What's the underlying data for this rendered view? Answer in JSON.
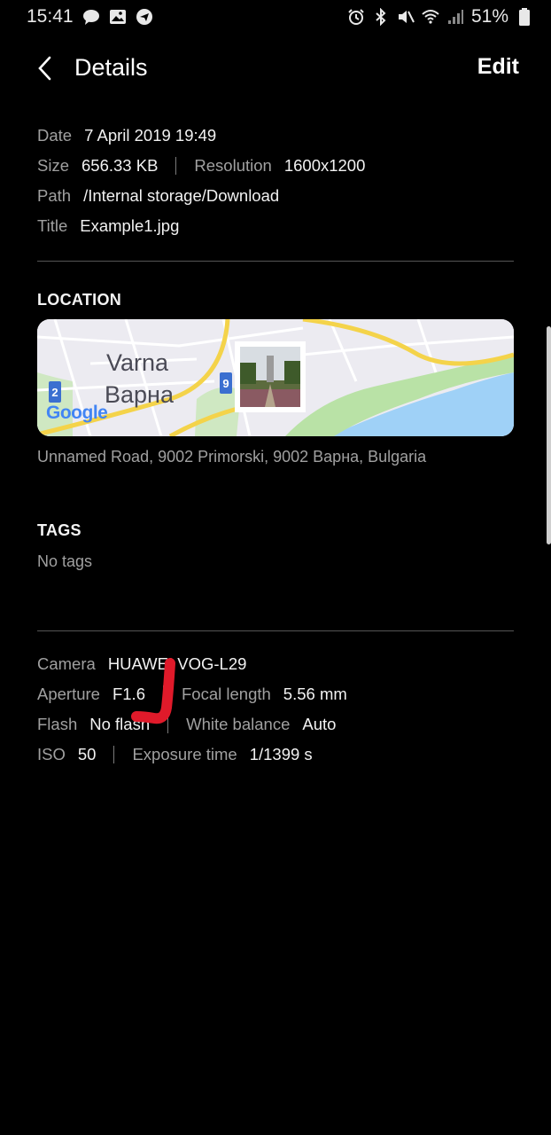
{
  "status_bar": {
    "time": "15:41",
    "battery": "51%"
  },
  "header": {
    "title": "Details",
    "edit_label": "Edit"
  },
  "file_info": {
    "date_label": "Date",
    "date_value": "7 April 2019 19:49",
    "size_label": "Size",
    "size_value": "656.33 KB",
    "resolution_label": "Resolution",
    "resolution_value": "1600x1200",
    "path_label": "Path",
    "path_value": "/Internal storage/Download",
    "title_label": "Title",
    "title_value": "Example1.jpg"
  },
  "location": {
    "heading": "LOCATION",
    "map_city_latin": "Varna",
    "map_city_cyrillic": "Варна",
    "map_provider": "Google",
    "road_badge_1": "2",
    "road_badge_2": "9",
    "address": "Unnamed Road, 9002 Primorski, 9002 Варна, Bulgaria"
  },
  "tags": {
    "heading": "TAGS",
    "empty_text": "No tags"
  },
  "camera_info": {
    "camera_label": "Camera",
    "camera_value": "HUAWEI VOG-L29",
    "aperture_label": "Aperture",
    "aperture_value": "F1.6",
    "focal_label": "Focal length",
    "focal_value": "5.56 mm",
    "flash_label": "Flash",
    "flash_value": "No flash",
    "wb_label": "White balance",
    "wb_value": "Auto",
    "iso_label": "ISO",
    "iso_value": "50",
    "exposure_label": "Exposure time",
    "exposure_value": "1/1399 s"
  },
  "colors": {
    "background": "#000000",
    "label": "#a0a0a0",
    "value": "#f2f2f2",
    "annotation": "#e01a2a"
  }
}
